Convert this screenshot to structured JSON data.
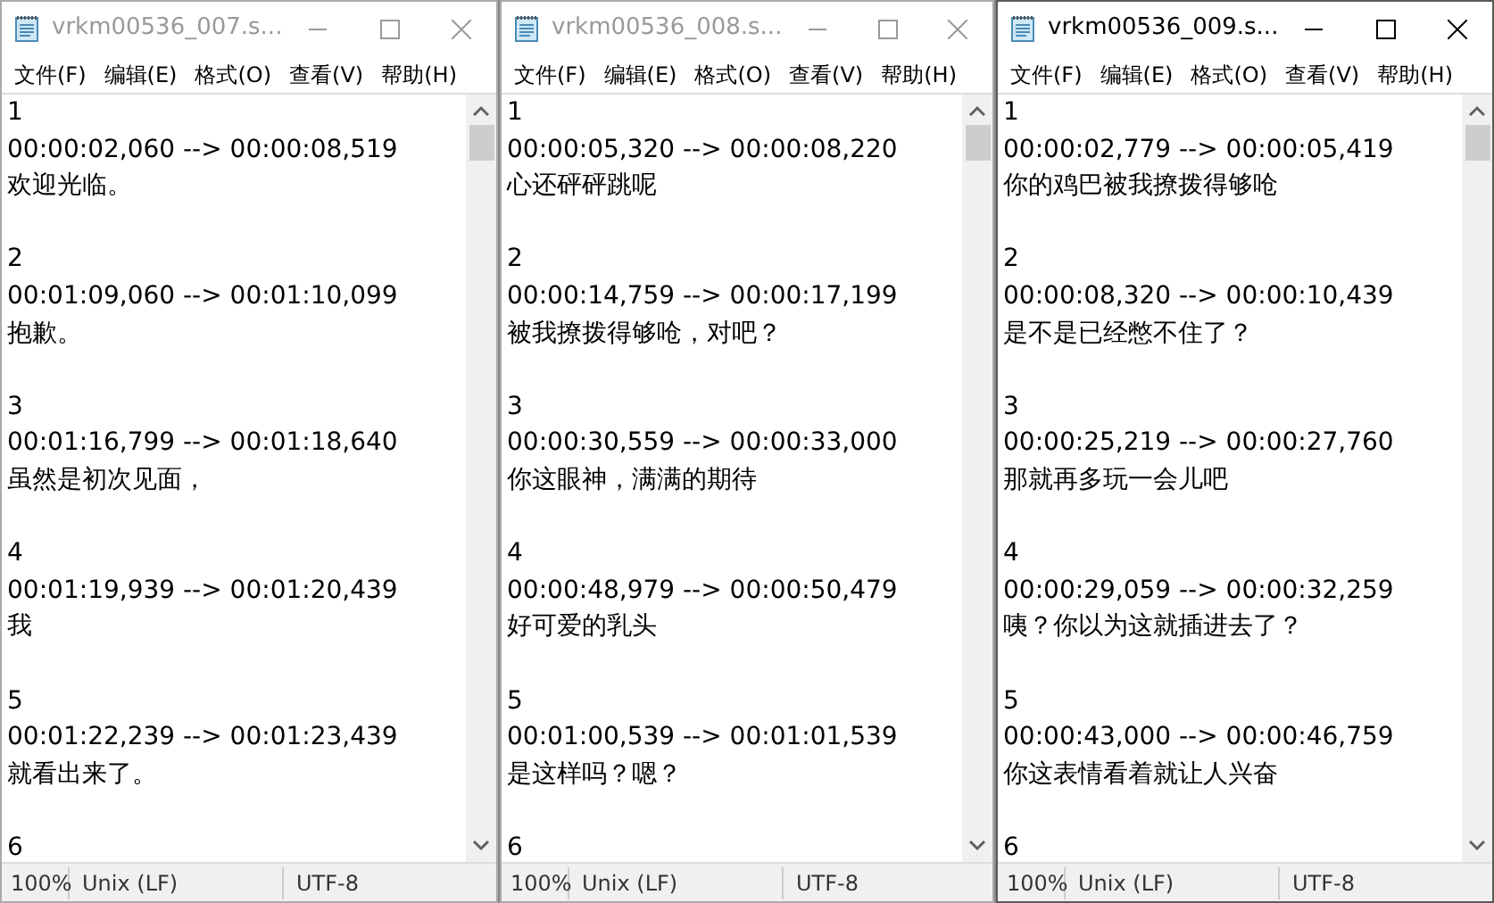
{
  "windows": [
    {
      "title": "vrkm00536_007.s...",
      "active": false,
      "menu": [
        "文件(F)",
        "编辑(E)",
        "格式(O)",
        "查看(V)",
        "帮助(H)"
      ],
      "entries": [
        {
          "number": "1",
          "time": "00:00:02,060 --> 00:00:08,519",
          "text": "欢迎光临。"
        },
        {
          "number": "2",
          "time": "00:01:09,060 --> 00:01:10,099",
          "text": "抱歉。"
        },
        {
          "number": "3",
          "time": "00:01:16,799 --> 00:01:18,640",
          "text": "虽然是初次见面，"
        },
        {
          "number": "4",
          "time": "00:01:19,939 --> 00:01:20,439",
          "text": "我"
        },
        {
          "number": "5",
          "time": "00:01:22,239 --> 00:01:23,439",
          "text": "就看出来了。"
        },
        {
          "number": "6"
        }
      ],
      "status": {
        "zoom": "100%",
        "line_ending": "Unix (LF)",
        "encoding": "UTF-8"
      }
    },
    {
      "title": "vrkm00536_008.s...",
      "active": false,
      "menu": [
        "文件(F)",
        "编辑(E)",
        "格式(O)",
        "查看(V)",
        "帮助(H)"
      ],
      "entries": [
        {
          "number": "1",
          "time": "00:00:05,320 --> 00:00:08,220",
          "text": "心还砰砰跳呢"
        },
        {
          "number": "2",
          "time": "00:00:14,759 --> 00:00:17,199",
          "text": "被我撩拨得够呛，对吧？"
        },
        {
          "number": "3",
          "time": "00:00:30,559 --> 00:00:33,000",
          "text": "你这眼神，满满的期待"
        },
        {
          "number": "4",
          "time": "00:00:48,979 --> 00:00:50,479",
          "text": "好可爱的乳头"
        },
        {
          "number": "5",
          "time": "00:01:00,539 --> 00:01:01,539",
          "text": "是这样吗？嗯？"
        },
        {
          "number": "6"
        }
      ],
      "status": {
        "zoom": "100%",
        "line_ending": "Unix (LF)",
        "encoding": "UTF-8"
      }
    },
    {
      "title": "vrkm00536_009.s...",
      "active": true,
      "menu": [
        "文件(F)",
        "编辑(E)",
        "格式(O)",
        "查看(V)",
        "帮助(H)"
      ],
      "entries": [
        {
          "number": "1",
          "time": "00:00:02,779 --> 00:00:05,419",
          "text": "你的鸡巴被我撩拨得够呛"
        },
        {
          "number": "2",
          "time": "00:00:08,320 --> 00:00:10,439",
          "text": "是不是已经憋不住了？"
        },
        {
          "number": "3",
          "time": "00:00:25,219 --> 00:00:27,760",
          "text": "那就再多玩一会儿吧"
        },
        {
          "number": "4",
          "time": "00:00:29,059 --> 00:00:32,259",
          "text": "咦？你以为这就插进去了？"
        },
        {
          "number": "5",
          "time": "00:00:43,000 --> 00:00:46,759",
          "text": "你这表情看着就让人兴奋"
        },
        {
          "number": "6"
        }
      ],
      "status": {
        "zoom": "100%",
        "line_ending": "Unix (LF)",
        "encoding": "UTF-8"
      }
    }
  ]
}
